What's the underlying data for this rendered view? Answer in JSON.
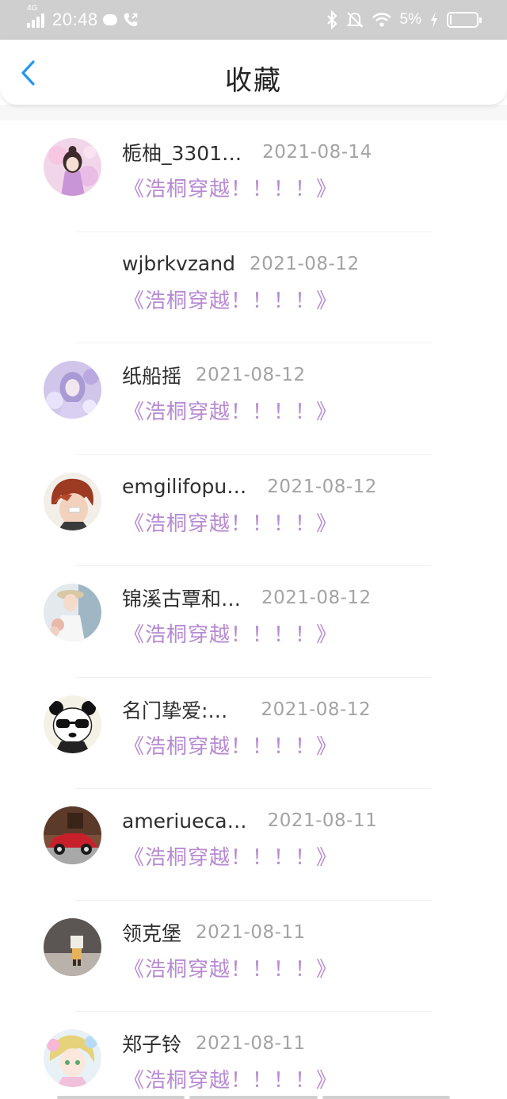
{
  "status_bar": {
    "network": "4G",
    "time": "20:48",
    "battery": "5%",
    "battery_level": 0.05,
    "icons": [
      "signal-icon",
      "chat-badge-icon",
      "phone-icon",
      "bluetooth-icon",
      "mute-icon",
      "wifi-icon",
      "charging-icon",
      "battery-icon"
    ]
  },
  "header": {
    "title": "收藏",
    "back_icon": "chevron-left-icon"
  },
  "colors": {
    "accent": "#2196f3",
    "link": "#b78ad2",
    "name": "#2e2e2e",
    "date": "#a3a3a3"
  },
  "favorites": [
    {
      "name": "栀柚_3301…",
      "date": "2021-08-14",
      "title": "《浩桐穿越！！！！》",
      "avatar": "girl-pink"
    },
    {
      "name": "wjbrkvzand",
      "date": "2021-08-12",
      "title": "《浩桐穿越！！！！》",
      "avatar": "none"
    },
    {
      "name": "纸船摇",
      "date": "2021-08-12",
      "title": "《浩桐穿越！！！！》",
      "avatar": "girl-lavender"
    },
    {
      "name": "emgilifopu…",
      "date": "2021-08-12",
      "title": "《浩桐穿越！！！！》",
      "avatar": "anime-boy"
    },
    {
      "name": "锦溪古覃和…",
      "date": "2021-08-12",
      "title": "《浩桐穿越！！！！》",
      "avatar": "girl-hat"
    },
    {
      "name": "名门挚爱:…",
      "date": "2021-08-12",
      "title": "《浩桐穿越！！！！》",
      "avatar": "panda"
    },
    {
      "name": "ameriueca…",
      "date": "2021-08-11",
      "title": "《浩桐穿越！！！！》",
      "avatar": "red-car"
    },
    {
      "name": "领克堡",
      "date": "2021-08-11",
      "title": "《浩桐穿越！！！！》",
      "avatar": "toy-figure"
    },
    {
      "name": "郑子铃",
      "date": "2021-08-11",
      "title": "《浩桐穿越！！！！》",
      "avatar": "girl-pastel"
    }
  ]
}
